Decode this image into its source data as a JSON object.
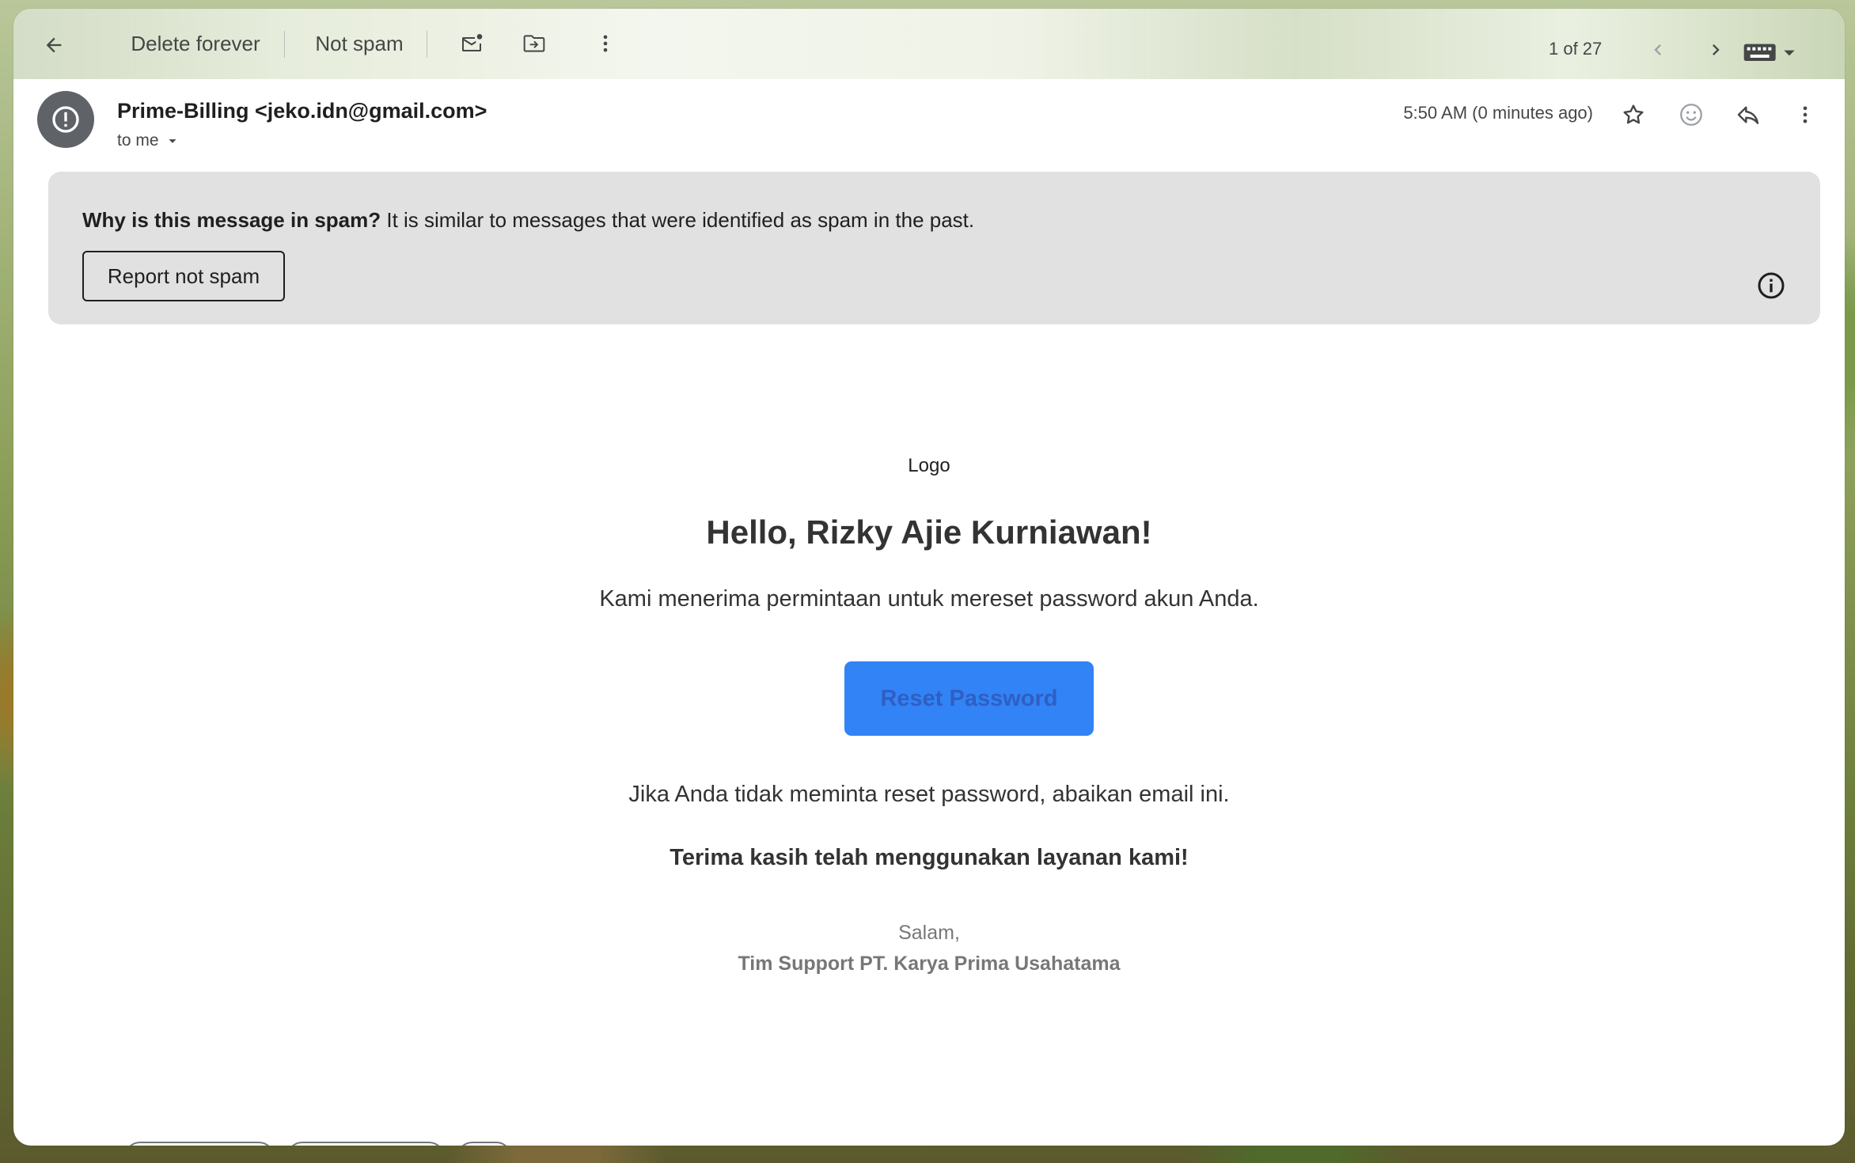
{
  "toolbar": {
    "delete_label": "Delete forever",
    "not_spam_label": "Not spam",
    "pagination": "1 of 27"
  },
  "message": {
    "sender": "Prime-Billing <jeko.idn@gmail.com>",
    "recipient": "to me",
    "timestamp": "5:50 AM (0 minutes ago)"
  },
  "spam_banner": {
    "question": "Why is this message in spam?",
    "explanation": " It is similar to messages that were identified as spam in the past.",
    "button_label": "Report not spam"
  },
  "email": {
    "logo_text": "Logo",
    "greeting": "Hello, Rizky Ajie Kurniawan!",
    "intro": "Kami menerima permintaan untuk mereset password akun Anda.",
    "button_label": "Reset Password",
    "ignore_note": "Jika Anda tidak meminta reset password, abaikan email ini.",
    "thanks": "Terima kasih telah menggunakan layanan kami!",
    "closing": "Salam,",
    "signature": "Tim Support PT. Karya Prima Usahatama"
  },
  "colors": {
    "reset_button_bg": "#3283f5",
    "reset_button_text": "#2f5fc3",
    "banner_bg": "#e1e1e1",
    "avatar_bg": "#5f6368"
  },
  "icons": {
    "back": "arrow-left-icon",
    "mark_unread": "mail-unread-icon",
    "move_to": "move-to-folder-icon",
    "more": "more-vert-icon",
    "prev": "chevron-left-icon",
    "next": "chevron-right-icon",
    "input_tools": "keyboard-icon",
    "spam_alert": "alert-circle-icon",
    "star": "star-icon",
    "emoji": "emoji-icon",
    "reply": "reply-icon",
    "info": "info-icon"
  }
}
